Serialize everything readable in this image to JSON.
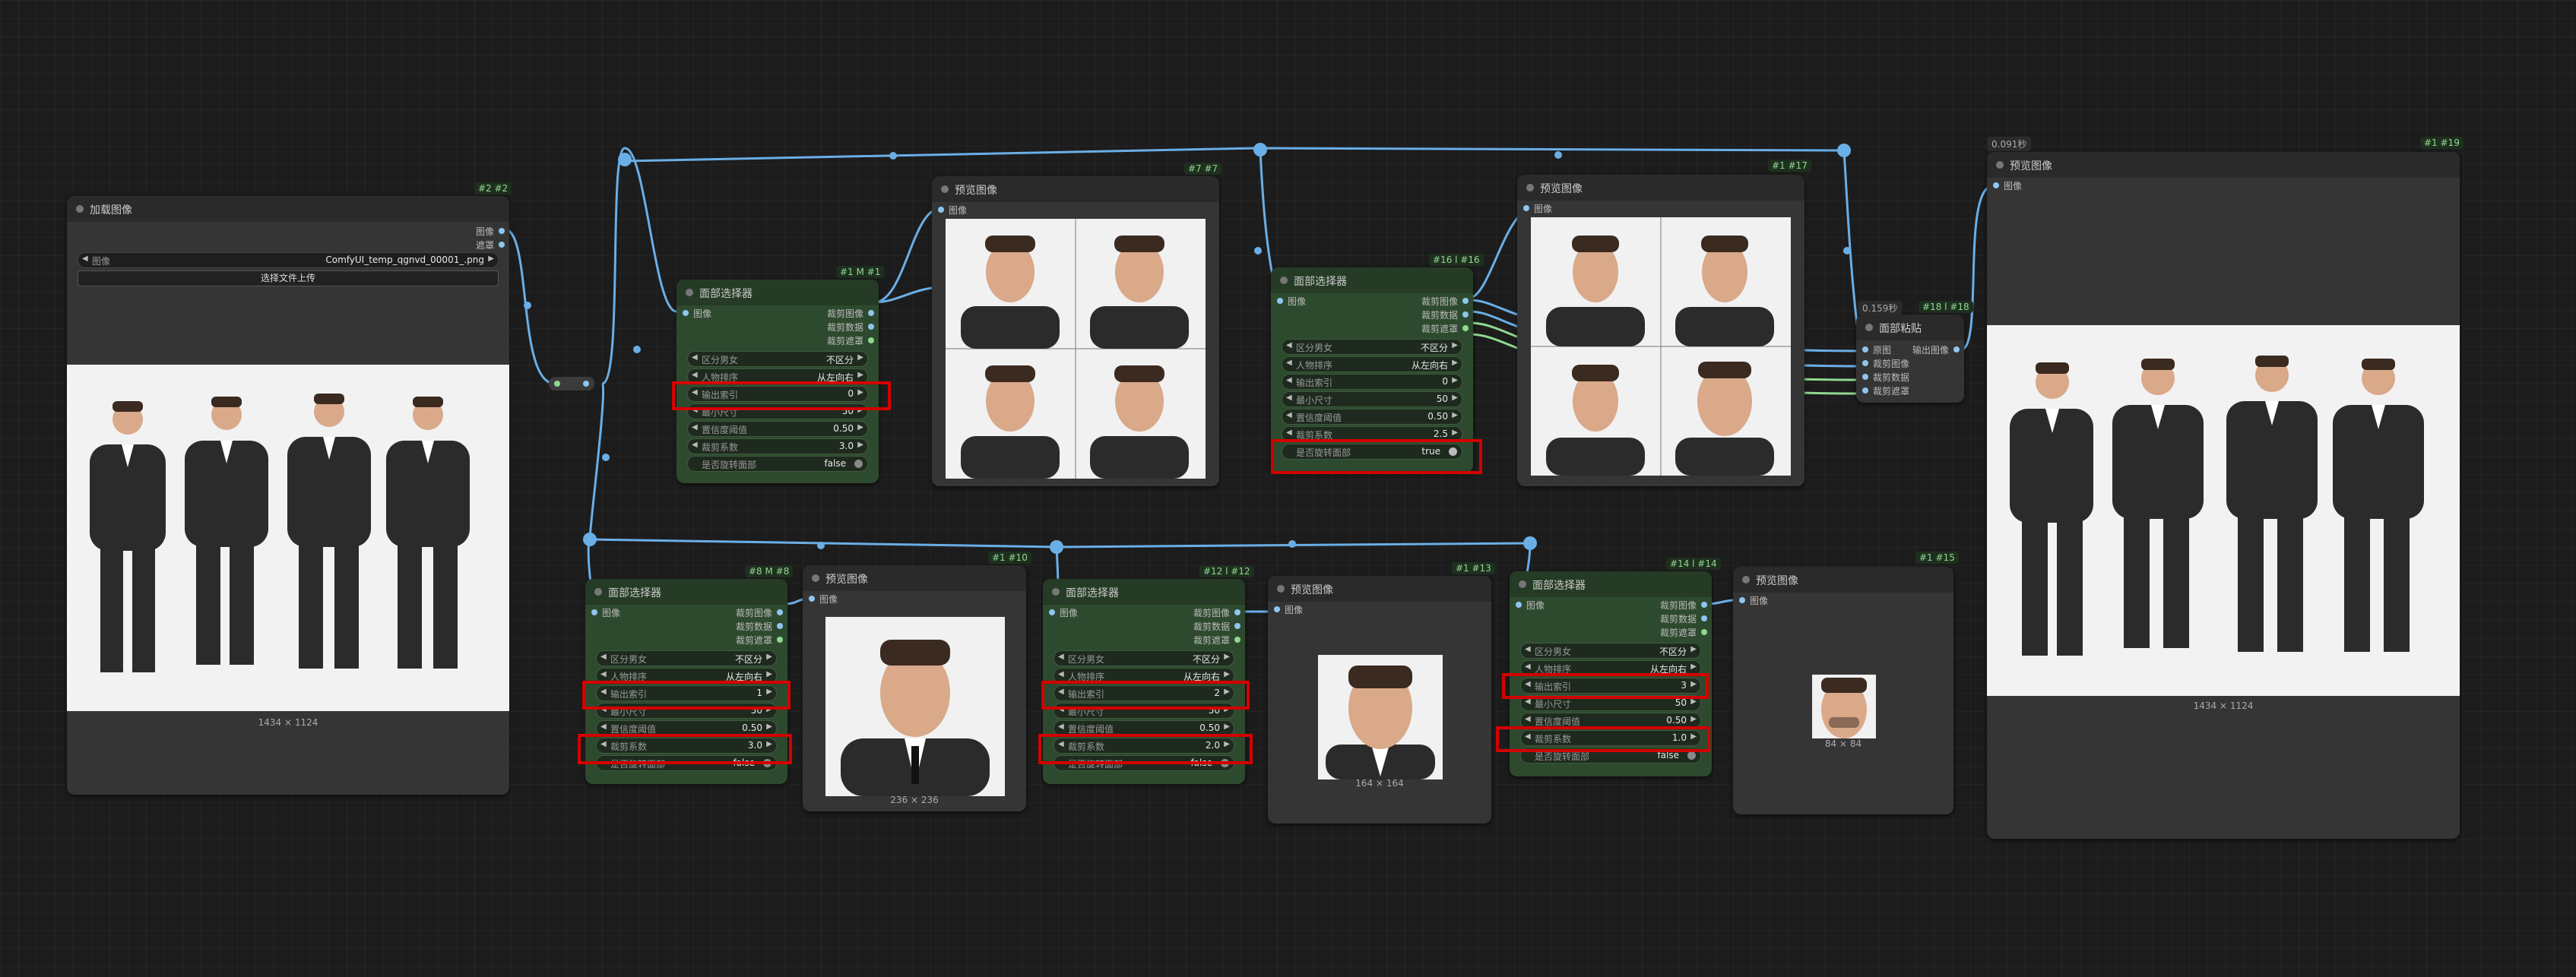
{
  "nodes": {
    "load_image": {
      "title": "加载图像",
      "badge": "#2 #2",
      "out_image": "图像",
      "out_mask": "遮罩",
      "image_label": "图像",
      "image_value": "ComfyUI_temp_qgnvd_00001_.png",
      "upload_label": "选择文件上传",
      "image_size": "1434 × 1124"
    },
    "face_sel_1": {
      "title": "面部选择器",
      "badge": "#1 M #1",
      "in_image": "图像",
      "out_crop_image": "裁剪图像",
      "out_crop_data": "裁剪数据",
      "out_crop_mask": "裁剪遮罩",
      "gender_label": "区分男女",
      "gender_value": "不区分",
      "order_label": "人物排序",
      "order_value": "从左向右",
      "index_label": "输出索引",
      "index_value": "0",
      "min_size_label": "最小尺寸",
      "min_size_value": "50",
      "conf_label": "置信度阈值",
      "conf_value": "0.50",
      "crop_label": "裁剪系数",
      "crop_value": "3.0",
      "rotate_label": "是否旋转面部",
      "rotate_value": "false"
    },
    "preview_7": {
      "title": "预览图像",
      "badge": "#7 #7",
      "in_image": "图像"
    },
    "face_sel_16": {
      "title": "面部选择器",
      "badge": "#16 l #16",
      "in_image": "图像",
      "out_crop_image": "裁剪图像",
      "out_crop_data": "裁剪数据",
      "out_crop_mask": "裁剪遮罩",
      "gender_label": "区分男女",
      "gender_value": "不区分",
      "order_label": "人物排序",
      "order_value": "从左向右",
      "index_label": "输出索引",
      "index_value": "0",
      "min_size_label": "最小尺寸",
      "min_size_value": "50",
      "conf_label": "置信度阈值",
      "conf_value": "0.50",
      "crop_label": "裁剪系数",
      "crop_value": "2.5",
      "rotate_label": "是否旋转面部",
      "rotate_value": "true"
    },
    "preview_17": {
      "title": "预览图像",
      "badge": "#1 #17",
      "in_image": "图像"
    },
    "face_paste": {
      "title": "面部粘贴",
      "badge": "#18 l #18",
      "timing": "0.159秒",
      "in_orig": "原图",
      "in_crop_image": "裁剪图像",
      "in_crop_data": "裁剪数据",
      "in_crop_mask": "裁剪遮罩",
      "out_image": "输出图像"
    },
    "preview_19": {
      "title": "预览图像",
      "badge": "#1 #19",
      "timing": "0.091秒",
      "in_image": "图像",
      "image_size": "1434 × 1124"
    },
    "face_sel_8": {
      "title": "面部选择器",
      "badge": "#8 M #8",
      "in_image": "图像",
      "out_crop_image": "裁剪图像",
      "out_crop_data": "裁剪数据",
      "out_crop_mask": "裁剪遮罩",
      "gender_label": "区分男女",
      "gender_value": "不区分",
      "order_label": "人物排序",
      "order_value": "从左向右",
      "index_label": "输出索引",
      "index_value": "1",
      "min_size_label": "最小尺寸",
      "min_size_value": "50",
      "conf_label": "置信度阈值",
      "conf_value": "0.50",
      "crop_label": "裁剪系数",
      "crop_value": "3.0",
      "rotate_label": "是否旋转面部",
      "rotate_value": "false"
    },
    "preview_10": {
      "title": "预览图像",
      "badge": "#1 #10",
      "in_image": "图像",
      "image_size": "236 × 236"
    },
    "face_sel_12": {
      "title": "面部选择器",
      "badge": "#12 l #12",
      "in_image": "图像",
      "out_crop_image": "裁剪图像",
      "out_crop_data": "裁剪数据",
      "out_crop_mask": "裁剪遮罩",
      "gender_label": "区分男女",
      "gender_value": "不区分",
      "order_label": "人物排序",
      "order_value": "从左向右",
      "index_label": "输出索引",
      "index_value": "2",
      "min_size_label": "最小尺寸",
      "min_size_value": "50",
      "conf_label": "置信度阈值",
      "conf_value": "0.50",
      "crop_label": "裁剪系数",
      "crop_value": "2.0",
      "rotate_label": "是否旋转面部",
      "rotate_value": "false"
    },
    "preview_13": {
      "title": "预览图像",
      "badge": "#1 #13",
      "in_image": "图像",
      "image_size": "164 × 164"
    },
    "face_sel_14": {
      "title": "面部选择器",
      "badge": "#14 l #14",
      "in_image": "图像",
      "out_crop_image": "裁剪图像",
      "out_crop_data": "裁剪数据",
      "out_crop_mask": "裁剪遮罩",
      "gender_label": "区分男女",
      "gender_value": "不区分",
      "order_label": "人物排序",
      "order_value": "从左向右",
      "index_label": "输出索引",
      "index_value": "3",
      "min_size_label": "最小尺寸",
      "min_size_value": "50",
      "conf_label": "置信度阈值",
      "conf_value": "0.50",
      "crop_label": "裁剪系数",
      "crop_value": "1.0",
      "rotate_label": "是否旋转面部",
      "rotate_value": "false"
    },
    "preview_15": {
      "title": "预览图像",
      "badge": "#1 #15",
      "in_image": "图像",
      "image_size": "84 × 84"
    }
  },
  "colors": {
    "link_image": "#6aaee6",
    "link_data": "#8fd88f",
    "highlight": "#d40000",
    "node_green": "#2e4a2e",
    "node_gray": "#353535"
  }
}
